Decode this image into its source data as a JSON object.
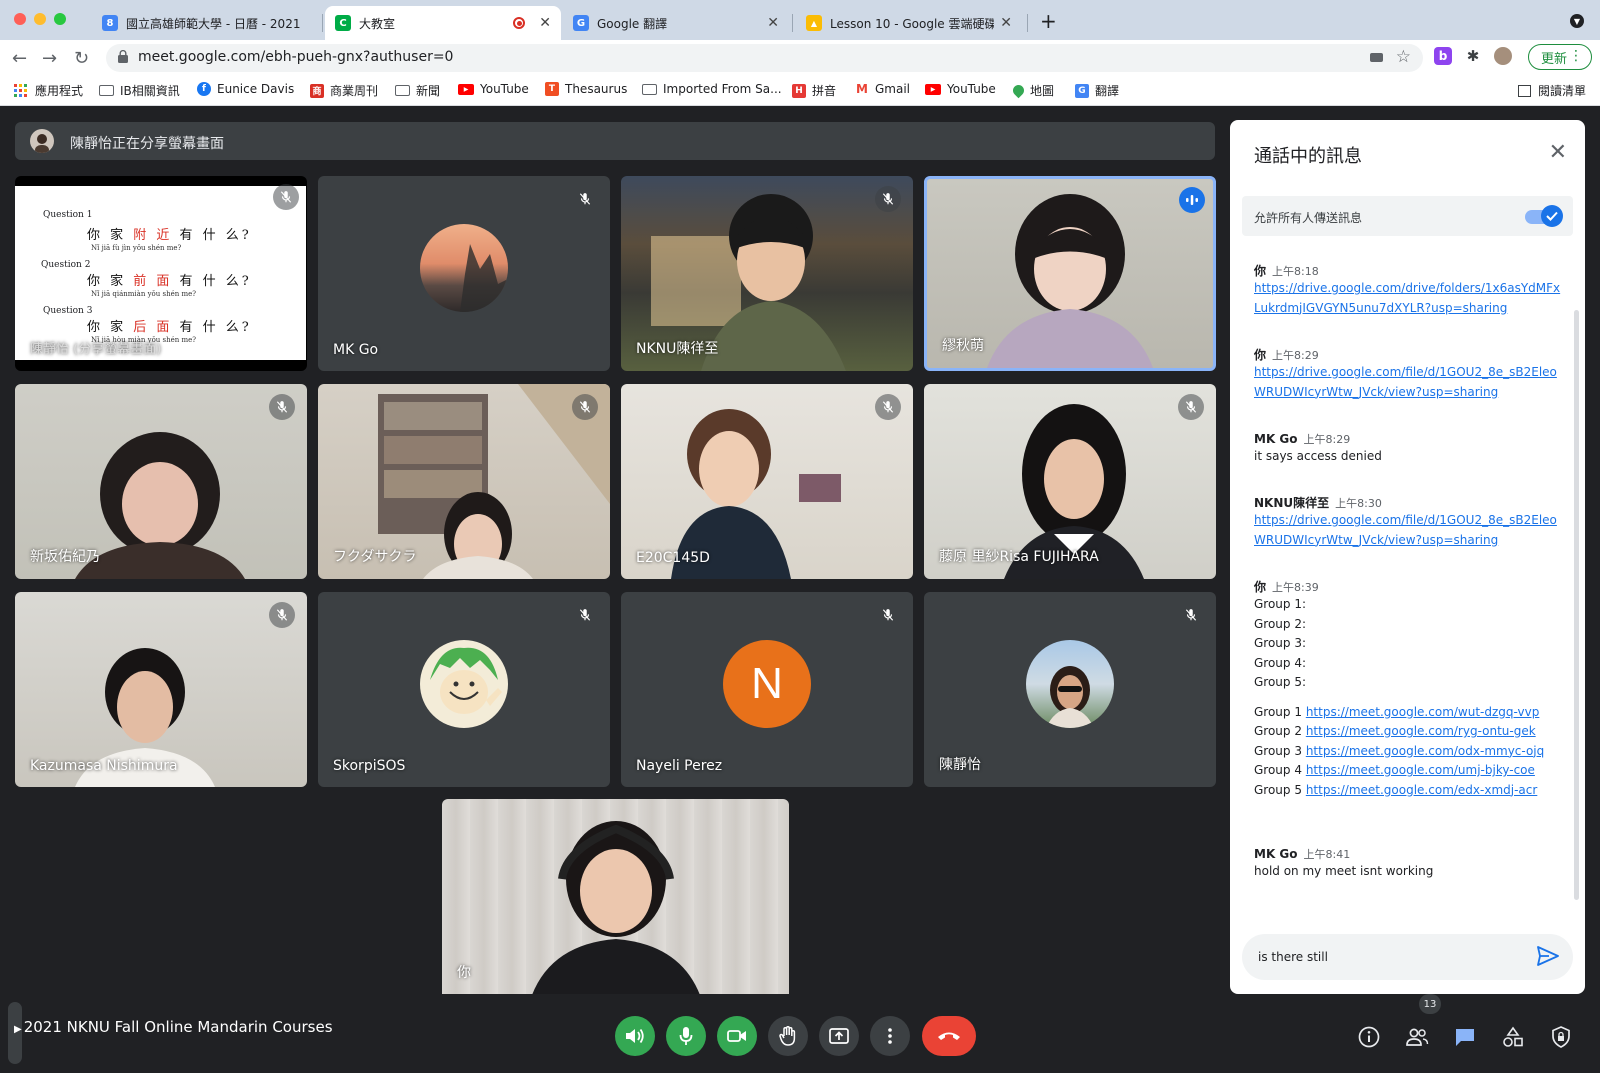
{
  "browser": {
    "tabs": [
      {
        "title": "國立高雄師範大學 - 日曆 - 2021",
        "fav_color": "#4285f4",
        "fav_text": "8"
      },
      {
        "title": "大教室",
        "fav_color": "#00ac47",
        "fav_text": "C"
      },
      {
        "title": "Google 翻譯",
        "fav_color": "#4285f4",
        "fav_text": "G"
      },
      {
        "title": "Lesson 10 - Google 雲端硬碟",
        "fav_color": "#fbbc04",
        "fav_text": "▲"
      }
    ],
    "url": "meet.google.com/ebh-pueh-gnx?authuser=0",
    "update_label": "更新",
    "bookmarks": [
      "應用程式",
      "IB相關資訊",
      "Eunice Davis",
      "商業周刊",
      "新聞",
      "YouTube",
      "Thesaurus",
      "Imported From Sa...",
      "拼音",
      "Gmail",
      "YouTube",
      "地圖",
      "翻譯"
    ],
    "reading_list": "閱讀清單",
    "ext_b": "b"
  },
  "meet": {
    "presenter_text": "陳靜怡正在分享螢幕畫面",
    "slide": {
      "q1": "Question 1",
      "q1_zh_a": "你 家 ",
      "q1_zh_b": "附 近",
      "q1_zh_c": " 有 什 么?",
      "q1_py": "Nǐ  jiā   fù   jìn   yǒu shén me?",
      "q2": "Question 2",
      "q2_zh_a": "你 家 ",
      "q2_zh_b": "前 面",
      "q2_zh_c": " 有 什 么?",
      "q2_py": "Nǐ  jiā   qiánmiàn  yǒu shén me?",
      "q3": "Question 3",
      "q3_zh_a": "你 家 ",
      "q3_zh_b": "后 面",
      "q3_zh_c": " 有 什 么?",
      "q3_py": "Nǐ  jiā  hòu miàn yǒu shén me?",
      "tile_label": "陳靜怡 (分享螢幕畫面)"
    },
    "participants": [
      {
        "name": "MK Go"
      },
      {
        "name": "NKNU陳徉至"
      },
      {
        "name": "繆秋萌"
      },
      {
        "name": "新坂佑紀乃"
      },
      {
        "name": "フクダサクラ"
      },
      {
        "name": "E20C145D"
      },
      {
        "name": "藤原 里紗Risa FUJIHARA"
      },
      {
        "name": "Kazumasa Nishimura"
      },
      {
        "name": "SkorpiSOS"
      },
      {
        "name": "Nayeli Perez",
        "initial": "N"
      },
      {
        "name": "陳靜怡"
      },
      {
        "name": "你"
      }
    ]
  },
  "chat": {
    "title": "通話中的訊息",
    "allow_label": "允許所有人傳送訊息",
    "messages": [
      {
        "sender": "你",
        "time": "上午8:18",
        "lines": [
          "https://drive.google.com/drive/folders/1x6asYdMFx",
          "LukrdmjIGVGYN5unu7dXYLR?usp=sharing"
        ]
      },
      {
        "sender": "你",
        "time": "上午8:29",
        "lines": [
          "https://drive.google.com/file/d/1GOU2_8e_sB2Eleo",
          "WRUDWIcyrWtw_JVck/view?usp=sharing"
        ]
      },
      {
        "sender": "MK Go",
        "time": "上午8:29",
        "lines": [
          "it says access denied"
        ]
      },
      {
        "sender": "NKNU陳徉至",
        "time": "上午8:30",
        "lines": [
          "https://drive.google.com/file/d/1GOU2_8e_sB2Eleo",
          "WRUDWIcyrWtw_JVck/view?usp=sharing"
        ]
      },
      {
        "sender": "你",
        "time": "上午8:39",
        "groups": [
          "Group 1:",
          "Group 2:",
          "Group 3:",
          "Group 4:",
          "Group 5:"
        ],
        "links": [
          {
            "label": "Group 1",
            "url": "https://meet.google.com/wut-dzgq-vvp"
          },
          {
            "label": "Group 2",
            "url": "https://meet.google.com/ryg-ontu-gek"
          },
          {
            "label": "Group 3",
            "url": "https://meet.google.com/odx-mmyc-ojq"
          },
          {
            "label": "Group 4",
            "url": "https://meet.google.com/umj-bjky-coe"
          },
          {
            "label": "Group 5",
            "url": "https://meet.google.com/edx-xmdj-acr"
          }
        ]
      },
      {
        "sender": "MK Go",
        "time": "上午8:41",
        "lines": [
          "hold on my meet isnt working"
        ]
      }
    ],
    "compose_value": "is there still"
  },
  "bottom": {
    "meeting_title": "2021 NKNU Fall Online Mandarin Courses",
    "participant_count": "13"
  },
  "colors": {
    "meet_bg": "#202124",
    "tile_bg": "#3c4043",
    "green": "#34a853",
    "red": "#ea4335",
    "blue": "#1a73e8",
    "nayeli_avatar": "#e8711a"
  }
}
